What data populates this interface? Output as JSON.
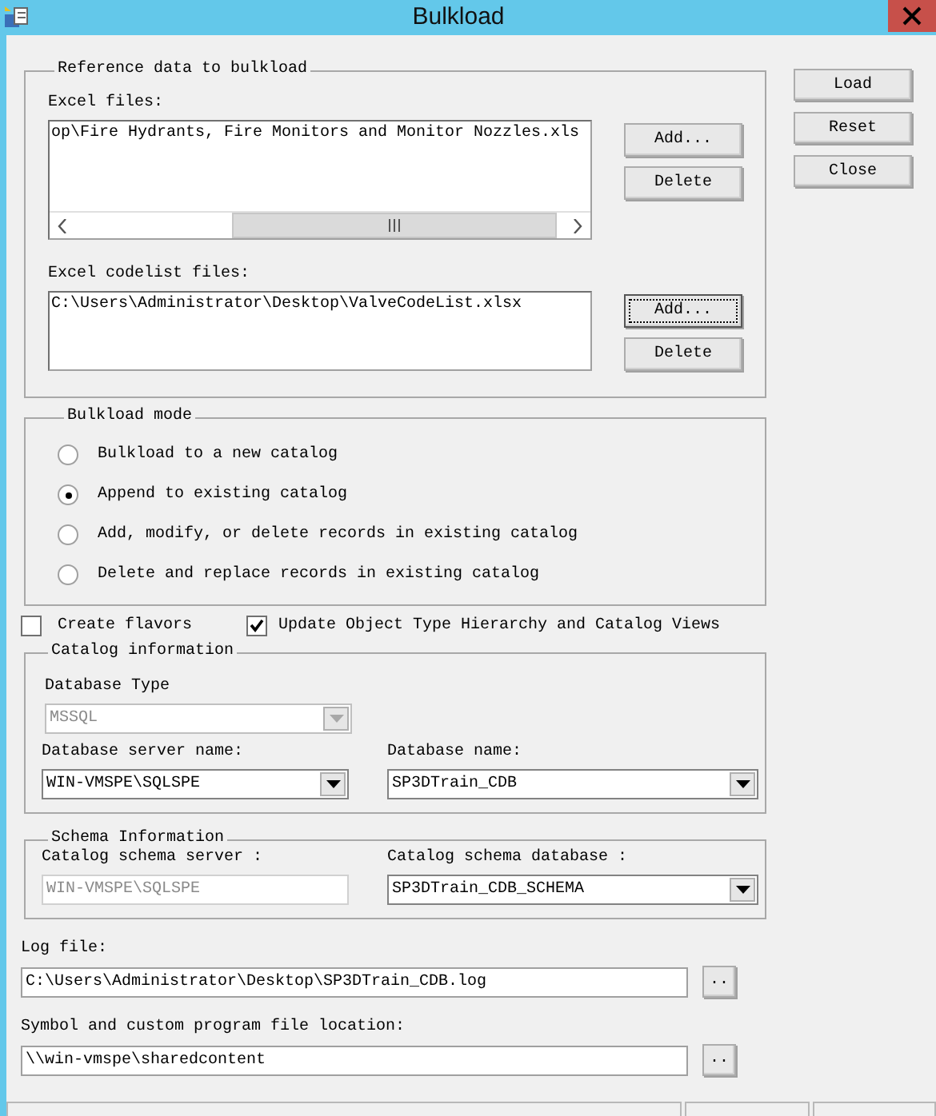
{
  "window": {
    "title": "Bulkload"
  },
  "reference": {
    "legend": "Reference data to bulkload",
    "lists": [
      {
        "label": "Excel files:",
        "items": [
          "op\\Fire Hydrants, Fire Monitors and Monitor Nozzles.xls"
        ],
        "scrollbar": true,
        "buttons": [
          {
            "label": "Add...",
            "focused": false
          },
          {
            "label": "Delete",
            "focused": false
          }
        ]
      },
      {
        "label": "Excel codelist files:",
        "items": [
          "C:\\Users\\Administrator\\Desktop\\ValveCodeList.xlsx"
        ],
        "scrollbar": false,
        "buttons": [
          {
            "label": "Add...",
            "focused": true
          },
          {
            "label": "Delete",
            "focused": false
          }
        ]
      }
    ]
  },
  "actions": [
    "Load",
    "Reset",
    "Close"
  ],
  "mode": {
    "legend": "Bulkload mode",
    "options": [
      {
        "label": "Bulkload to a new catalog",
        "selected": false
      },
      {
        "label": "Append to existing  catalog",
        "selected": true
      },
      {
        "label": "Add, modify, or delete records in existing catalog",
        "selected": false
      },
      {
        "label": "Delete and replace records in existing catalog",
        "selected": false
      }
    ]
  },
  "checkboxes": [
    {
      "label": "Create flavors",
      "checked": false
    },
    {
      "label": "Update Object Type Hierarchy and Catalog Views",
      "checked": true
    }
  ],
  "catalog": {
    "legend": "Catalog information",
    "rows": [
      [
        {
          "label": "Database Type",
          "value": "MSSQL",
          "kind": "combo",
          "disabled": true
        }
      ],
      [
        {
          "label": "Database server name:",
          "value": "WIN-VMSPE\\SQLSPE",
          "kind": "combo",
          "disabled": false
        },
        {
          "label": "Database name:",
          "value": "SP3DTrain_CDB",
          "kind": "combo",
          "disabled": false
        }
      ]
    ]
  },
  "schema": {
    "legend": "Schema Information",
    "rows": [
      [
        {
          "label": "Catalog schema server :",
          "value": "WIN-VMSPE\\SQLSPE",
          "kind": "textbox",
          "disabled": true
        },
        {
          "label": "Catalog schema database :",
          "value": "SP3DTrain_CDB_SCHEMA",
          "kind": "combo",
          "disabled": false
        }
      ]
    ]
  },
  "paths": [
    {
      "label": "Log file:",
      "value": "C:\\Users\\Administrator\\Desktop\\SP3DTrain_CDB.log",
      "button": ".."
    },
    {
      "label": "Symbol and custom program file location:",
      "value": "\\\\win-vmspe\\sharedcontent",
      "button": ".."
    }
  ]
}
